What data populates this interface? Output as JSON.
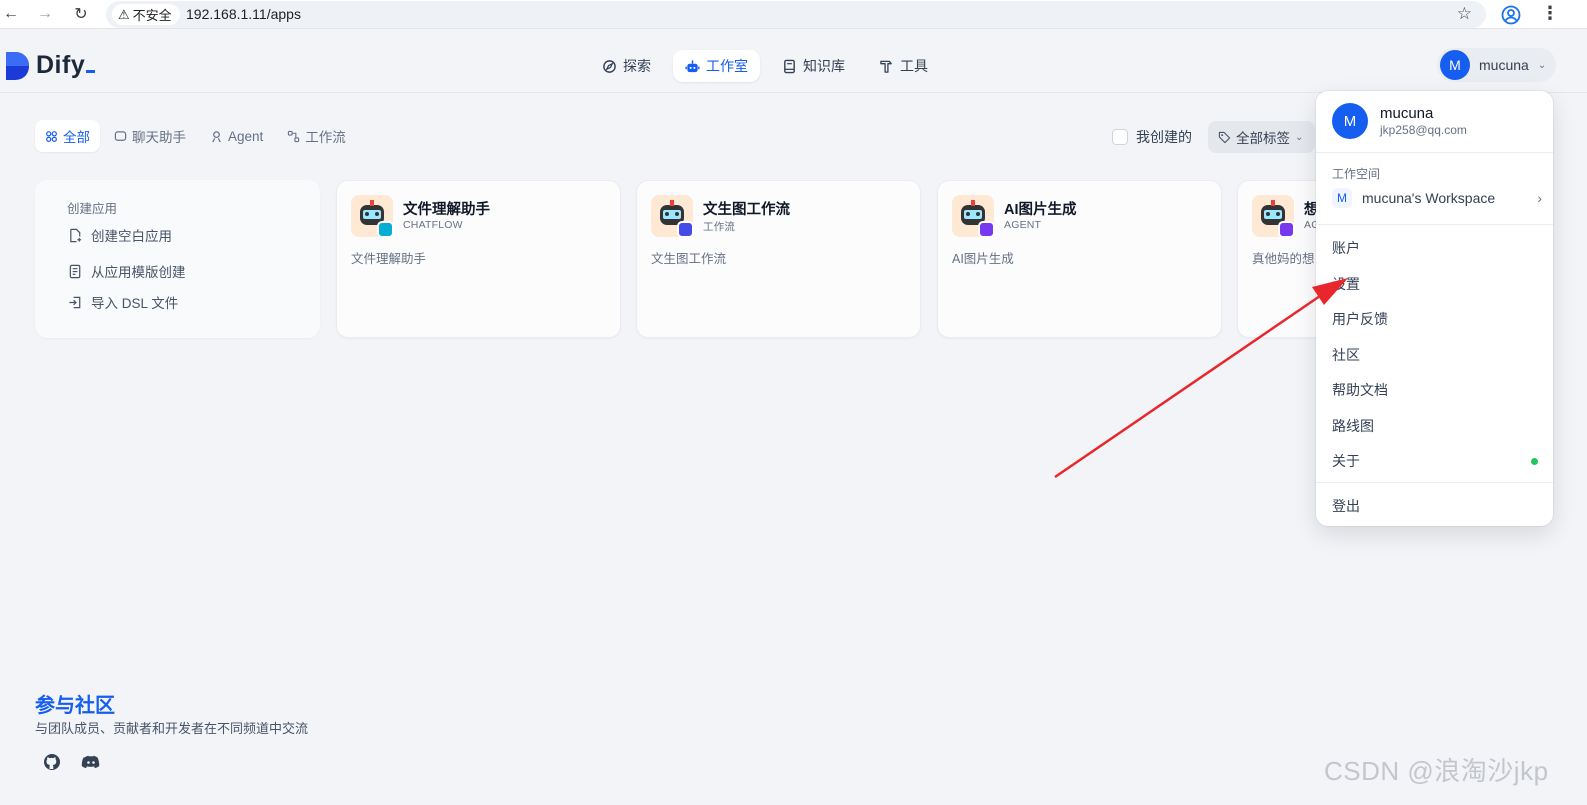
{
  "browser": {
    "security_label": "不安全",
    "url": "192.168.1.11/apps"
  },
  "header": {
    "logo_text": "Dify",
    "nav": [
      {
        "label": "探索",
        "icon": "compass-icon"
      },
      {
        "label": "工作室",
        "icon": "robot-icon",
        "active": true
      },
      {
        "label": "知识库",
        "icon": "book-icon"
      },
      {
        "label": "工具",
        "icon": "hammer-icon"
      }
    ],
    "user": {
      "initial": "M",
      "name": "mucuna"
    }
  },
  "filters": {
    "tabs": [
      {
        "label": "全部",
        "icon": "grid-icon",
        "active": true
      },
      {
        "label": "聊天助手",
        "icon": "chat-icon"
      },
      {
        "label": "Agent",
        "icon": "agent-icon"
      },
      {
        "label": "工作流",
        "icon": "workflow-icon"
      }
    ],
    "mine_label": "我创建的",
    "tags_label": "全部标签"
  },
  "create_card": {
    "title": "创建应用",
    "items": [
      {
        "label": "创建空白应用",
        "icon": "file-plus-icon"
      },
      {
        "label": "从应用模版创建",
        "icon": "template-icon"
      },
      {
        "label": "导入 DSL 文件",
        "icon": "import-icon"
      }
    ]
  },
  "apps": [
    {
      "name": "文件理解助手",
      "type": "CHATFLOW",
      "description": "文件理解助手",
      "badge_color": "#06aed4"
    },
    {
      "name": "文生图工作流",
      "type": "工作流",
      "description": "文生图工作流",
      "badge_color": "#444ce7"
    },
    {
      "name": "AI图片生成",
      "type": "AGENT",
      "description": "AI图片生成",
      "badge_color": "#7839ee"
    },
    {
      "name": "想",
      "type": "AG",
      "description": "真他妈的想",
      "badge_color": "#7839ee"
    }
  ],
  "footer": {
    "title": "参与社区",
    "subtitle": "与团队成员、贡献者和开发者在不同频道中交流"
  },
  "dropdown": {
    "name": "mucuna",
    "email": "jkp258@qq.com",
    "avatar_initial": "M",
    "workspace_label": "工作空间",
    "workspace_initial": "M",
    "workspace_name": "mucuna's Workspace",
    "items": [
      "账户",
      "设置",
      "用户反馈",
      "社区",
      "帮助文档",
      "路线图",
      "关于"
    ],
    "logout": "登出"
  },
  "watermark": "CSDN @浪淘沙jkp"
}
